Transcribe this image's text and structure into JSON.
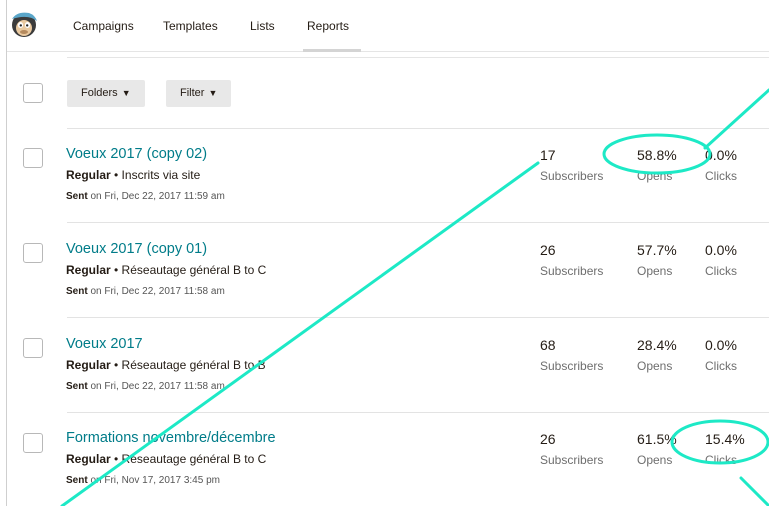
{
  "nav": {
    "items": [
      {
        "label": "Campaigns"
      },
      {
        "label": "Templates"
      },
      {
        "label": "Lists"
      },
      {
        "label": "Reports"
      }
    ],
    "active": "Reports"
  },
  "toolbar": {
    "folders_label": "Folders",
    "filter_label": "Filter"
  },
  "campaigns": [
    {
      "title": "Voeux 2017 (copy 02)",
      "type": "Regular",
      "list": " • Inscrits via site",
      "sent_prefix": "Sent",
      "sent_date": " on Fri, Dec 22, 2017 11:59 am",
      "subscribers": "17",
      "opens": "58.8%",
      "clicks": "0.0%"
    },
    {
      "title": "Voeux 2017 (copy 01)",
      "type": "Regular",
      "list": " • Réseautage général B to C",
      "sent_prefix": "Sent",
      "sent_date": " on Fri, Dec 22, 2017 11:58 am",
      "subscribers": "26",
      "opens": "57.7%",
      "clicks": "0.0%"
    },
    {
      "title": "Voeux 2017",
      "type": "Regular",
      "list": " • Réseautage général B to B",
      "sent_prefix": "Sent",
      "sent_date": " on Fri, Dec 22, 2017 11:58 am",
      "subscribers": "68",
      "opens": "28.4%",
      "clicks": "0.0%"
    },
    {
      "title": "Formations novembre/décembre",
      "type": "Regular",
      "list": " • Réseautage général B to C",
      "sent_prefix": "Sent",
      "sent_date": " on Fri, Nov 17, 2017 3:45 pm",
      "subscribers": "26",
      "opens": "61.5%",
      "clicks": "15.4%"
    }
  ],
  "stat_labels": {
    "subscribers": "Subscribers",
    "opens": "Opens",
    "clicks": "Clicks"
  },
  "colors": {
    "link": "#007c89",
    "annotation": "#1de9c6"
  },
  "icons": {
    "logo": "mailchimp-freddie-logo",
    "dropdown": "chevron-down-icon"
  }
}
